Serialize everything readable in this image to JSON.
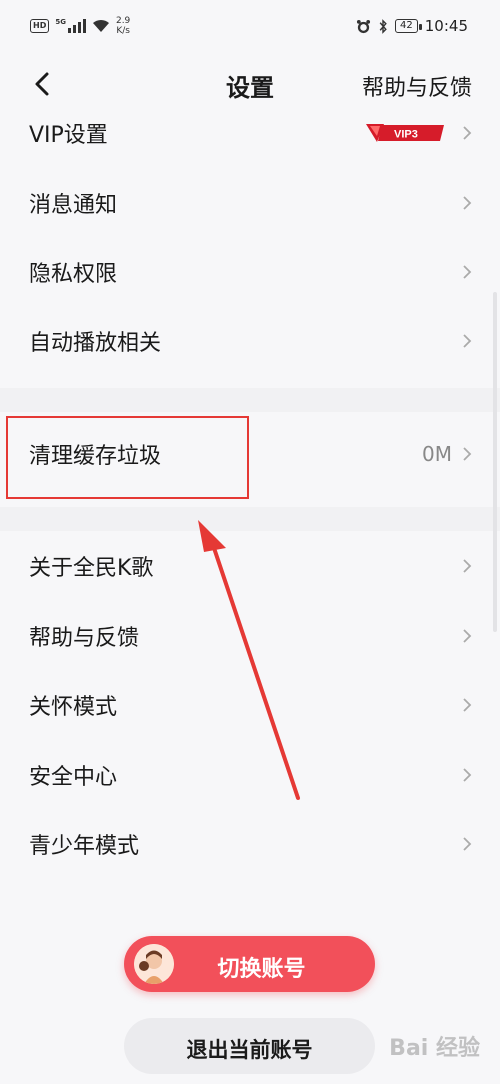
{
  "status_bar": {
    "network_badge": "HD",
    "signal_tag": "5G",
    "speed_value": "2.9",
    "speed_unit": "K/s",
    "battery": "42",
    "time": "10:45"
  },
  "header": {
    "title": "设置",
    "help_label": "帮助与反馈"
  },
  "settings_group_1": [
    {
      "label": "VIP设置",
      "badge": "VIP3"
    },
    {
      "label": "消息通知"
    },
    {
      "label": "隐私权限"
    },
    {
      "label": "自动播放相关"
    }
  ],
  "cache_row": {
    "label": "清理缓存垃圾",
    "value": "0M"
  },
  "settings_group_2": [
    {
      "label": "关于全民K歌"
    },
    {
      "label": "帮助与反馈"
    },
    {
      "label": "关怀模式"
    },
    {
      "label": "安全中心"
    },
    {
      "label": "青少年模式"
    }
  ],
  "buttons": {
    "switch_account": "切换账号",
    "logout": "退出当前账号"
  },
  "colors": {
    "accent": "#f2505a",
    "annotation": "#e53935"
  },
  "watermark": "Bai 经验"
}
